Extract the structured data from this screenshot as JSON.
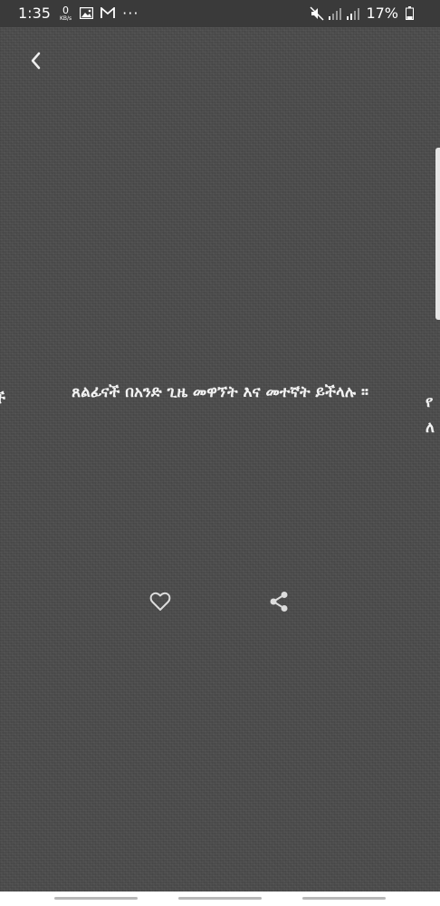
{
  "status_bar": {
    "time": "1:35",
    "data_speed_value": "0",
    "data_speed_unit": "KB/s",
    "more_indicator": "···",
    "battery_percent": "17%"
  },
  "quote": {
    "text": "ጸልፊናች በአንድ ጊዜ መዋኘት እና መተኛት ይችላሉ ።",
    "prev_peek": "ች",
    "next_peek_line1": "የ",
    "next_peek_line2": "ለ"
  },
  "colors": {
    "background": "#4b4b4b",
    "text": "#f2f2f2",
    "icon": "#dddddd"
  },
  "icons": {
    "back": "chevron-left-icon",
    "like": "heart-outline-icon",
    "share": "share-icon"
  }
}
